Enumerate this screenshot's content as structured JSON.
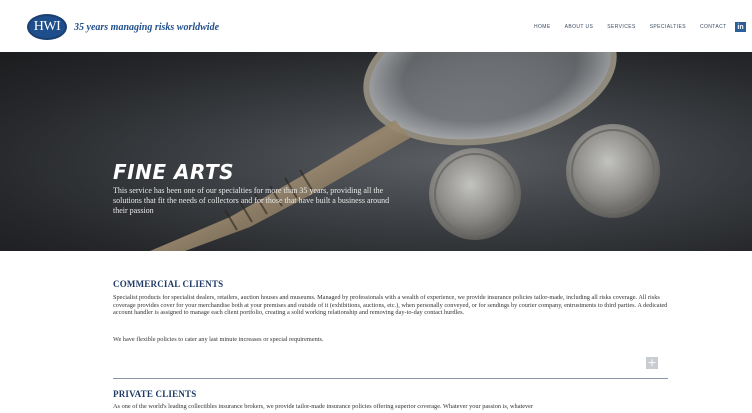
{
  "header": {
    "logo_text": "HWI",
    "tagline": "35 years managing risks worldwide",
    "nav": [
      "HOME",
      "ABOUT US",
      "SERVICES",
      "SPECIALTIES",
      "CONTACT"
    ],
    "social_icon": "linkedin-icon",
    "social_label": "in"
  },
  "hero": {
    "title": "FINE ARTS",
    "text": "This service has been one of our specialties for more than 35 years, providing all the solutions that fit the needs of collectors and for those that have built a business around their passion"
  },
  "sections": {
    "commercial": {
      "title": "COMMERCIAL CLIENTS",
      "paragraph1": "Specialist products for specialist dealers, retailers, auction houses and museums. Managed by professionals with a wealth of experience, we provide insurance policies tailor-made, including all risks coverage. All risks coverage provides cover for your merchandise both at your premises and outside of it (exhibitions, auctions, etc.), when personally conveyed, or for sendings by courier company, entrustments to third parties. A dedicated account handler is assigned to manage each client portfolio, creating a solid working relationship and removing day-to-day contact hurdles.",
      "paragraph2": "We have flexible policies to cater any last minute increases or special requirements.",
      "expand_label": "+"
    },
    "private": {
      "title": "PRIVATE CLIENTS",
      "paragraph1": "As one of the world's leading collectibles insurance brokers, we provide tailor-made insurance policies offering superior coverage. Whatever your passion is, whatever"
    }
  },
  "colors": {
    "brand_blue": "#1f4e8c",
    "heading_navy": "#1f3a66",
    "hero_dark": "#25272a"
  }
}
